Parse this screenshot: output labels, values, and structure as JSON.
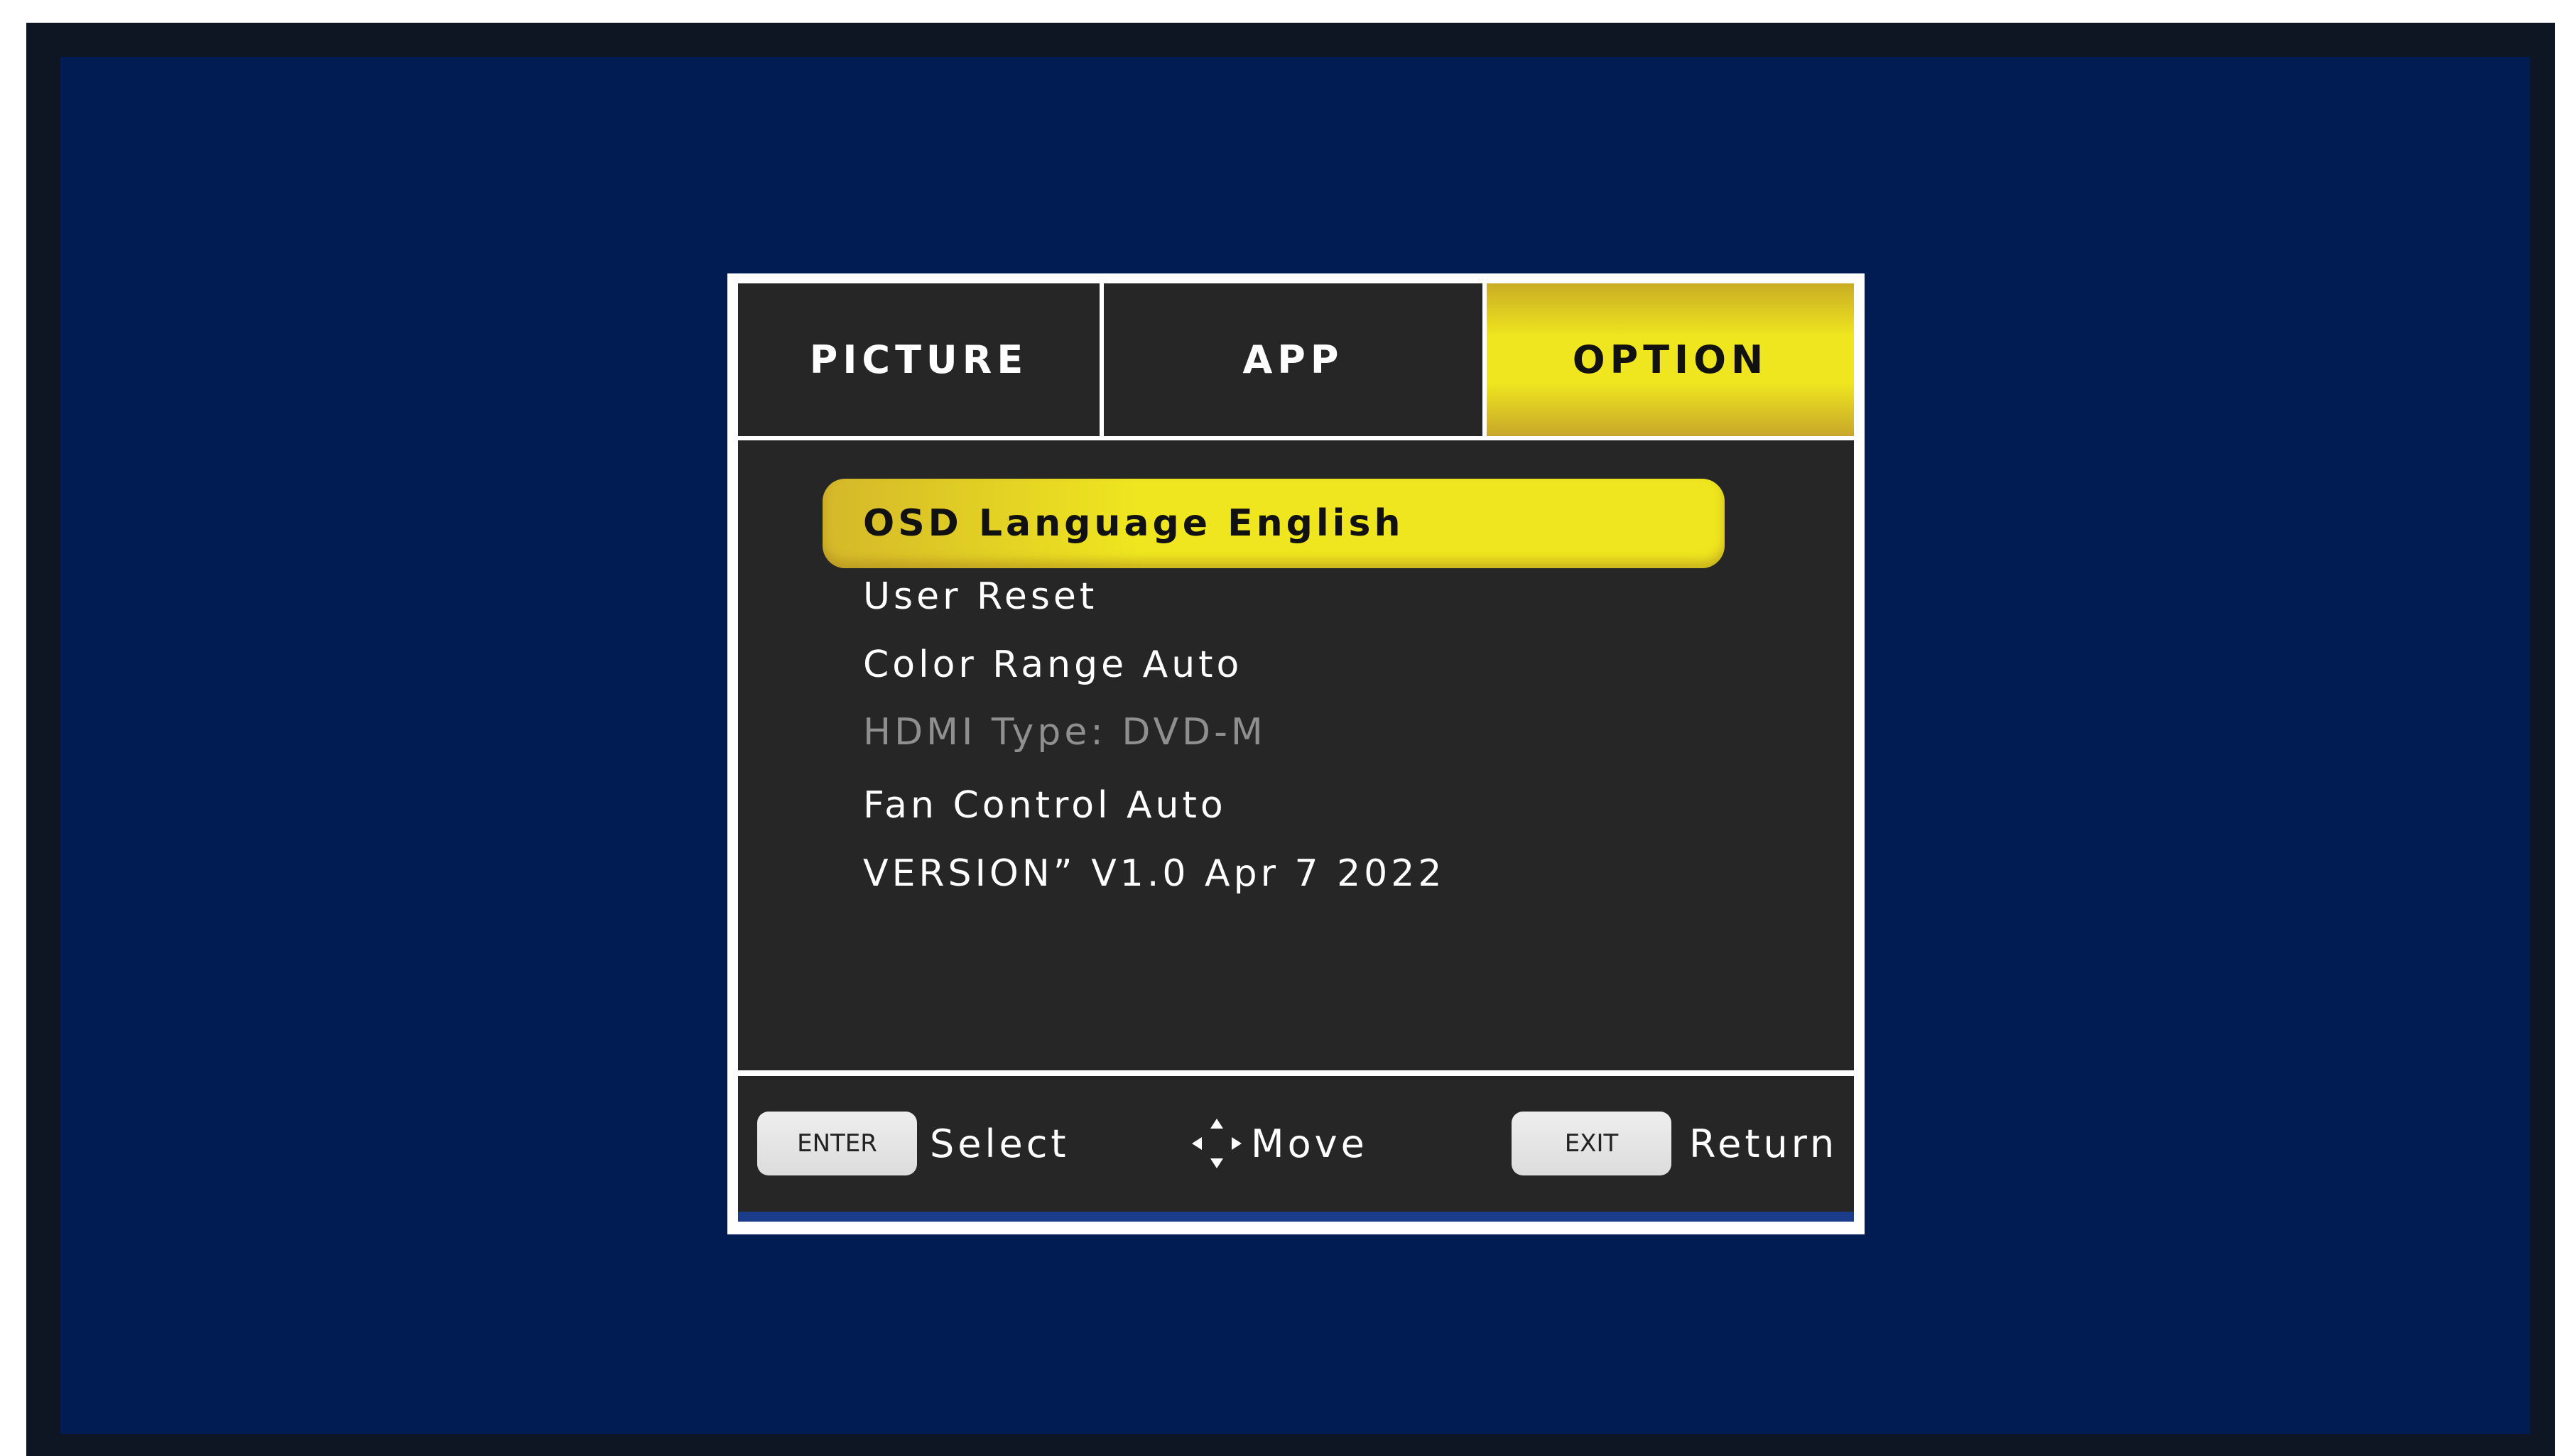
{
  "osd": {
    "tabs": [
      {
        "label": "PICTURE"
      },
      {
        "label": "APP"
      },
      {
        "label": "OPTION"
      }
    ],
    "active_tab": "OPTION",
    "menu": {
      "selected": "OSD Language English",
      "items": [
        {
          "label": "User Reset",
          "enabled": true
        },
        {
          "label": "Color Range Auto",
          "enabled": true
        },
        {
          "label": "HDMI Type: DVD-M",
          "enabled": false
        },
        {
          "label": "Fan Control Auto",
          "enabled": true
        },
        {
          "label": "VERSION” V1.0 Apr 7 2022",
          "enabled": true
        }
      ]
    },
    "footer": {
      "enter_key": "ENTER",
      "enter_action": "Select",
      "move_icon": "dpad-arrows-icon",
      "move_action": "Move",
      "exit_key": "EXIT",
      "exit_action": "Return"
    }
  },
  "colors": {
    "screen_background": "#001c52",
    "panel_background": "#262626",
    "highlight_yellow": "#efe61f",
    "disabled_text": "#8f8f8f"
  }
}
